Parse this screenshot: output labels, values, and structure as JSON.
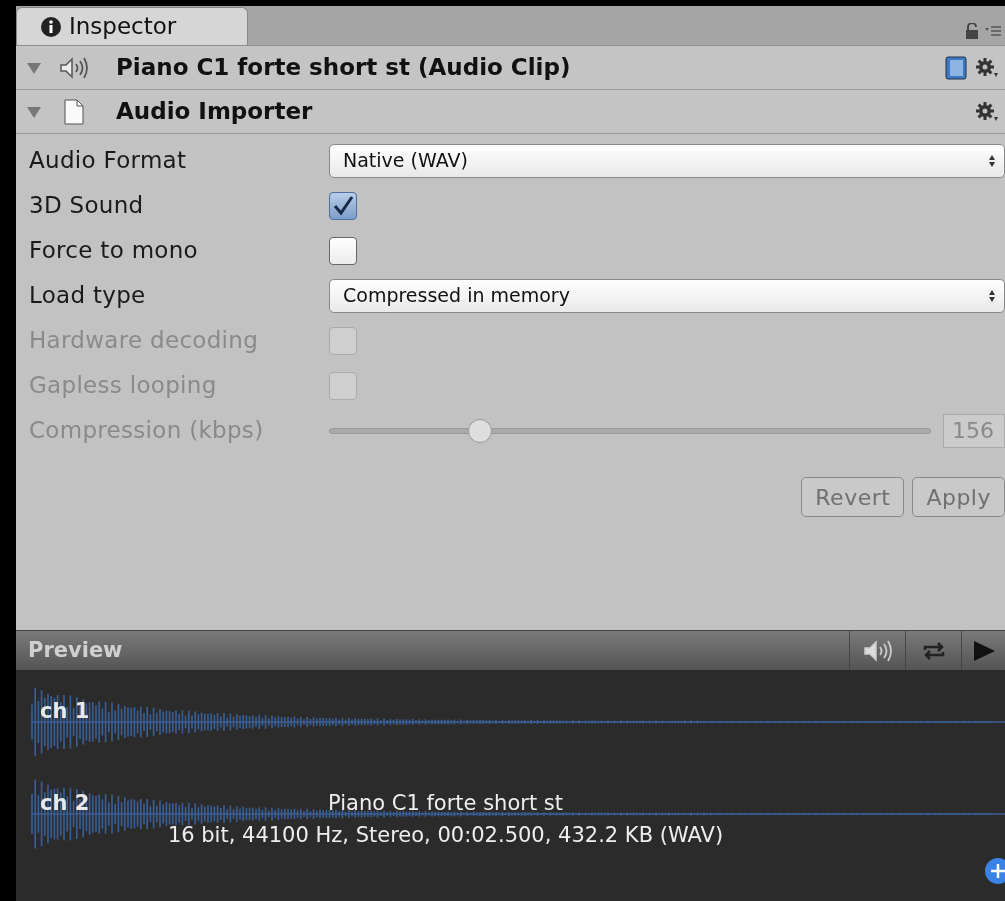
{
  "tab": {
    "label": "Inspector",
    "selected": true
  },
  "components": [
    {
      "title": "Piano C1 forte short st (Audio Clip)",
      "expanded": true,
      "kind": "clip"
    },
    {
      "title": "Audio Importer",
      "expanded": true,
      "kind": "importer"
    }
  ],
  "properties": [
    {
      "kind": "dropdown",
      "label": "Audio Format",
      "value": "Native (WAV)",
      "disabled": false
    },
    {
      "kind": "checkbox",
      "label": "3D Sound",
      "checked": true,
      "disabled": false
    },
    {
      "kind": "checkbox",
      "label": "Force to mono",
      "checked": false,
      "disabled": false
    },
    {
      "kind": "dropdown",
      "label": "Load type",
      "value": "Compressed in memory",
      "disabled": false
    },
    {
      "kind": "checkbox",
      "label": "Hardware decoding",
      "checked": false,
      "disabled": true
    },
    {
      "kind": "checkbox",
      "label": "Gapless looping",
      "checked": false,
      "disabled": true
    },
    {
      "kind": "slider",
      "label": "Compression (kbps)",
      "level": 0.25,
      "value": "156",
      "disabled": true
    }
  ],
  "buttons": [
    "Revert",
    "Apply"
  ],
  "preview": {
    "title": "Preview",
    "channels": [
      "ch 1",
      "ch 2"
    ],
    "clip_name": "Piano C1 forte short st",
    "clip_info": "16 bit, 44100 Hz, Stereo, 00:02.500, 432.2 KB (WAV)"
  }
}
